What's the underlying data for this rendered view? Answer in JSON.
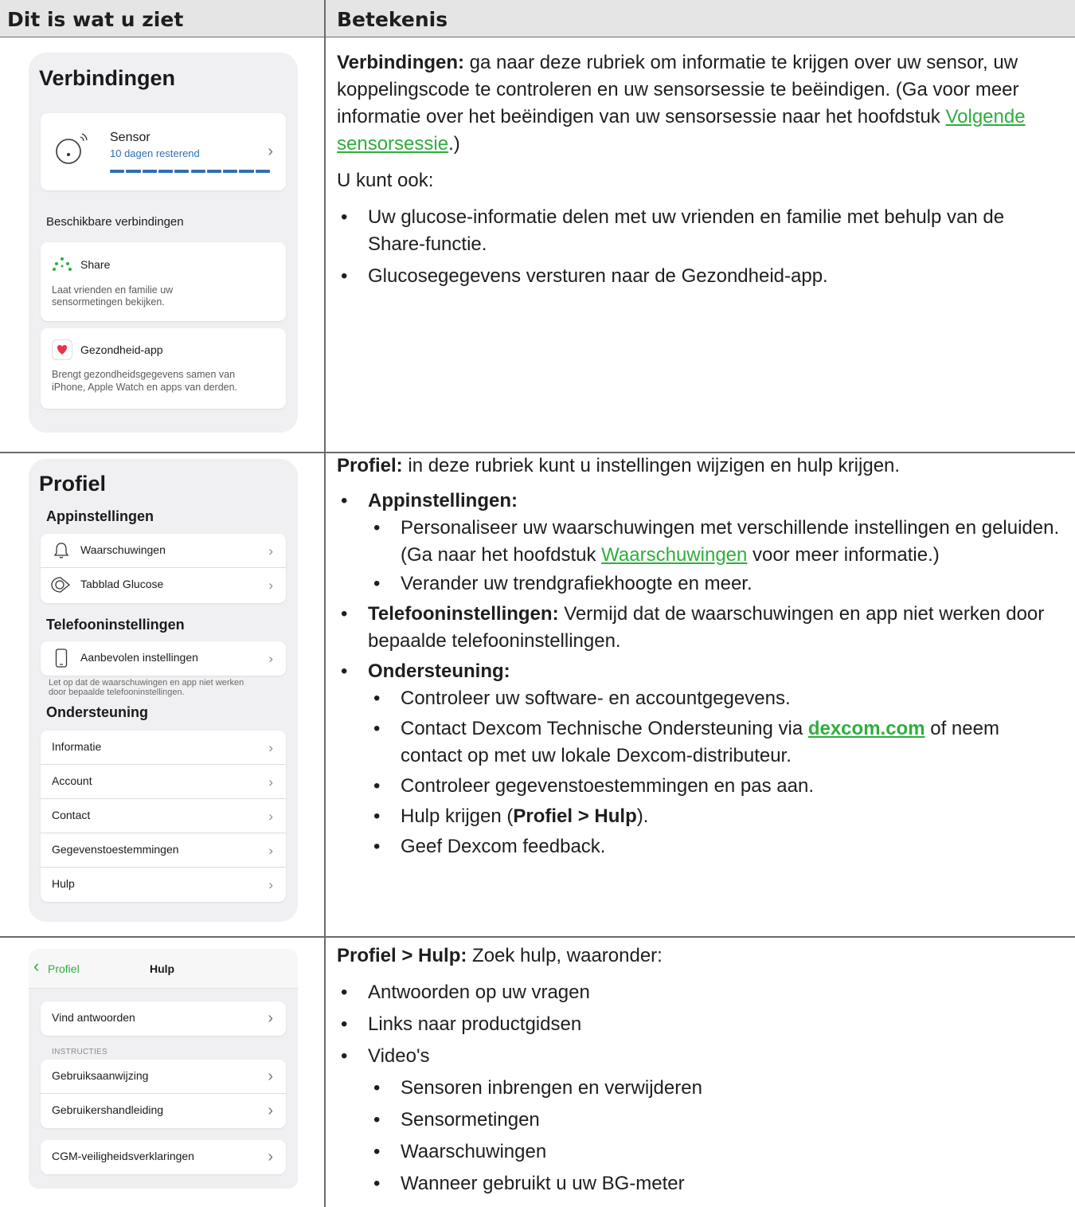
{
  "header": {
    "col1": "Dit is wat u ziet",
    "col2": "Betekenis"
  },
  "connections": {
    "title": "Verbindingen",
    "sensor": {
      "label": "Sensor",
      "sub": "10 dagen resterend",
      "progress": 1.0
    },
    "available_label": "Beschikbare verbindingen",
    "share": {
      "label": "Share",
      "desc1": "Laat vrienden en familie uw",
      "desc2": "sensormetingen bekijken."
    },
    "health": {
      "label": "Gezondheid-app",
      "desc1": "Brengt gezondheidsgegevens samen van",
      "desc2": "iPhone,  Apple Watch en apps van derden."
    }
  },
  "profile": {
    "title": "Profiel",
    "app_settings": "Appinstellingen",
    "alerts": "Waarschuwingen",
    "glucose_tab": "Tabblad Glucose",
    "phone_settings": "Telefooninstellingen",
    "recommended": "Aanbevolen instellingen",
    "note1": "Let op dat de waarschuwingen en app niet werken",
    "note2": "door bepaalde telefooninstellingen.",
    "support": "Ondersteuning",
    "support_items": [
      "Informatie",
      "Account",
      "Contact",
      "Gegevenstoestemmingen",
      "Hulp"
    ]
  },
  "help": {
    "back": "Profiel",
    "title": "Hulp",
    "find": "Vind antwoorden",
    "instructions": "INSTRUCTIES",
    "manual": "Gebruiksaanwijzing",
    "guide": "Gebruikershandleiding",
    "safety": "CGM-veiligheidsverklaringen"
  },
  "right": {
    "r1": {
      "bold": "Verbindingen:",
      "t1": " ga naar deze rubriek om informatie te krijgen over uw sensor, uw koppelingscode te controleren en uw sensorsessie te beëindigen. (Ga voor meer informatie over het beëindigen van uw sensorsessie naar het hoofdstuk ",
      "link": "Volgende sensorsessie",
      "t2": ".)",
      "p2": "U kunt ook:",
      "b1": "Uw glucose-informatie delen met uw vrienden en familie met behulp van de Share-functie.",
      "b2": "Glucosegegevens versturen naar de Gezondheid-app."
    },
    "r2": {
      "bold": "Profiel:",
      "t1": " in deze rubriek kunt u instellingen wijzigen en hulp krijgen.",
      "app_bold": "Appinstellingen:",
      "s1a": "Personaliseer uw waarschuwingen met verschillende instellingen en geluiden. (Ga naar het hoofdstuk ",
      "s1link": "Waarschuwingen",
      "s1b": " voor meer informatie.)",
      "s2": "Verander uw trendgrafiekhoogte en meer.",
      "phone_bold": "Telefooninstellingen:",
      "phone_t": " Vermijd dat de waarschuwingen en app niet werken door bepaalde telefooninstellingen.",
      "sup_bold": "Ondersteuning:",
      "u1": "Controleer uw software- en accountgegevens.",
      "u2a": "Contact Dexcom Technische Ondersteuning via ",
      "u2link": "dexcom.com",
      "u2b": " of neem contact op met uw lokale Dexcom-distributeur.",
      "u3": "Controleer gegevenstoestemmingen en pas aan.",
      "u4a": "Hulp krijgen (",
      "u4b": "Profiel > Hulp",
      "u4c": ").",
      "u5": "Geef Dexcom feedback."
    },
    "r3": {
      "bold": "Profiel > Hulp:",
      "t1": " Zoek hulp, waaronder:",
      "b1": "Antwoorden op uw vragen",
      "b2": "Links naar productgidsen",
      "b3": "Video's",
      "v1": "Sensoren inbrengen en verwijderen",
      "v2": "Sensormetingen",
      "v3": "Waarschuwingen",
      "v4": "Wanneer gebruikt u uw BG-meter"
    }
  },
  "colors": {
    "accent_green": "#2fae3e",
    "progress_blue": "#2f6fb5",
    "heart_red": "#e8344e"
  }
}
